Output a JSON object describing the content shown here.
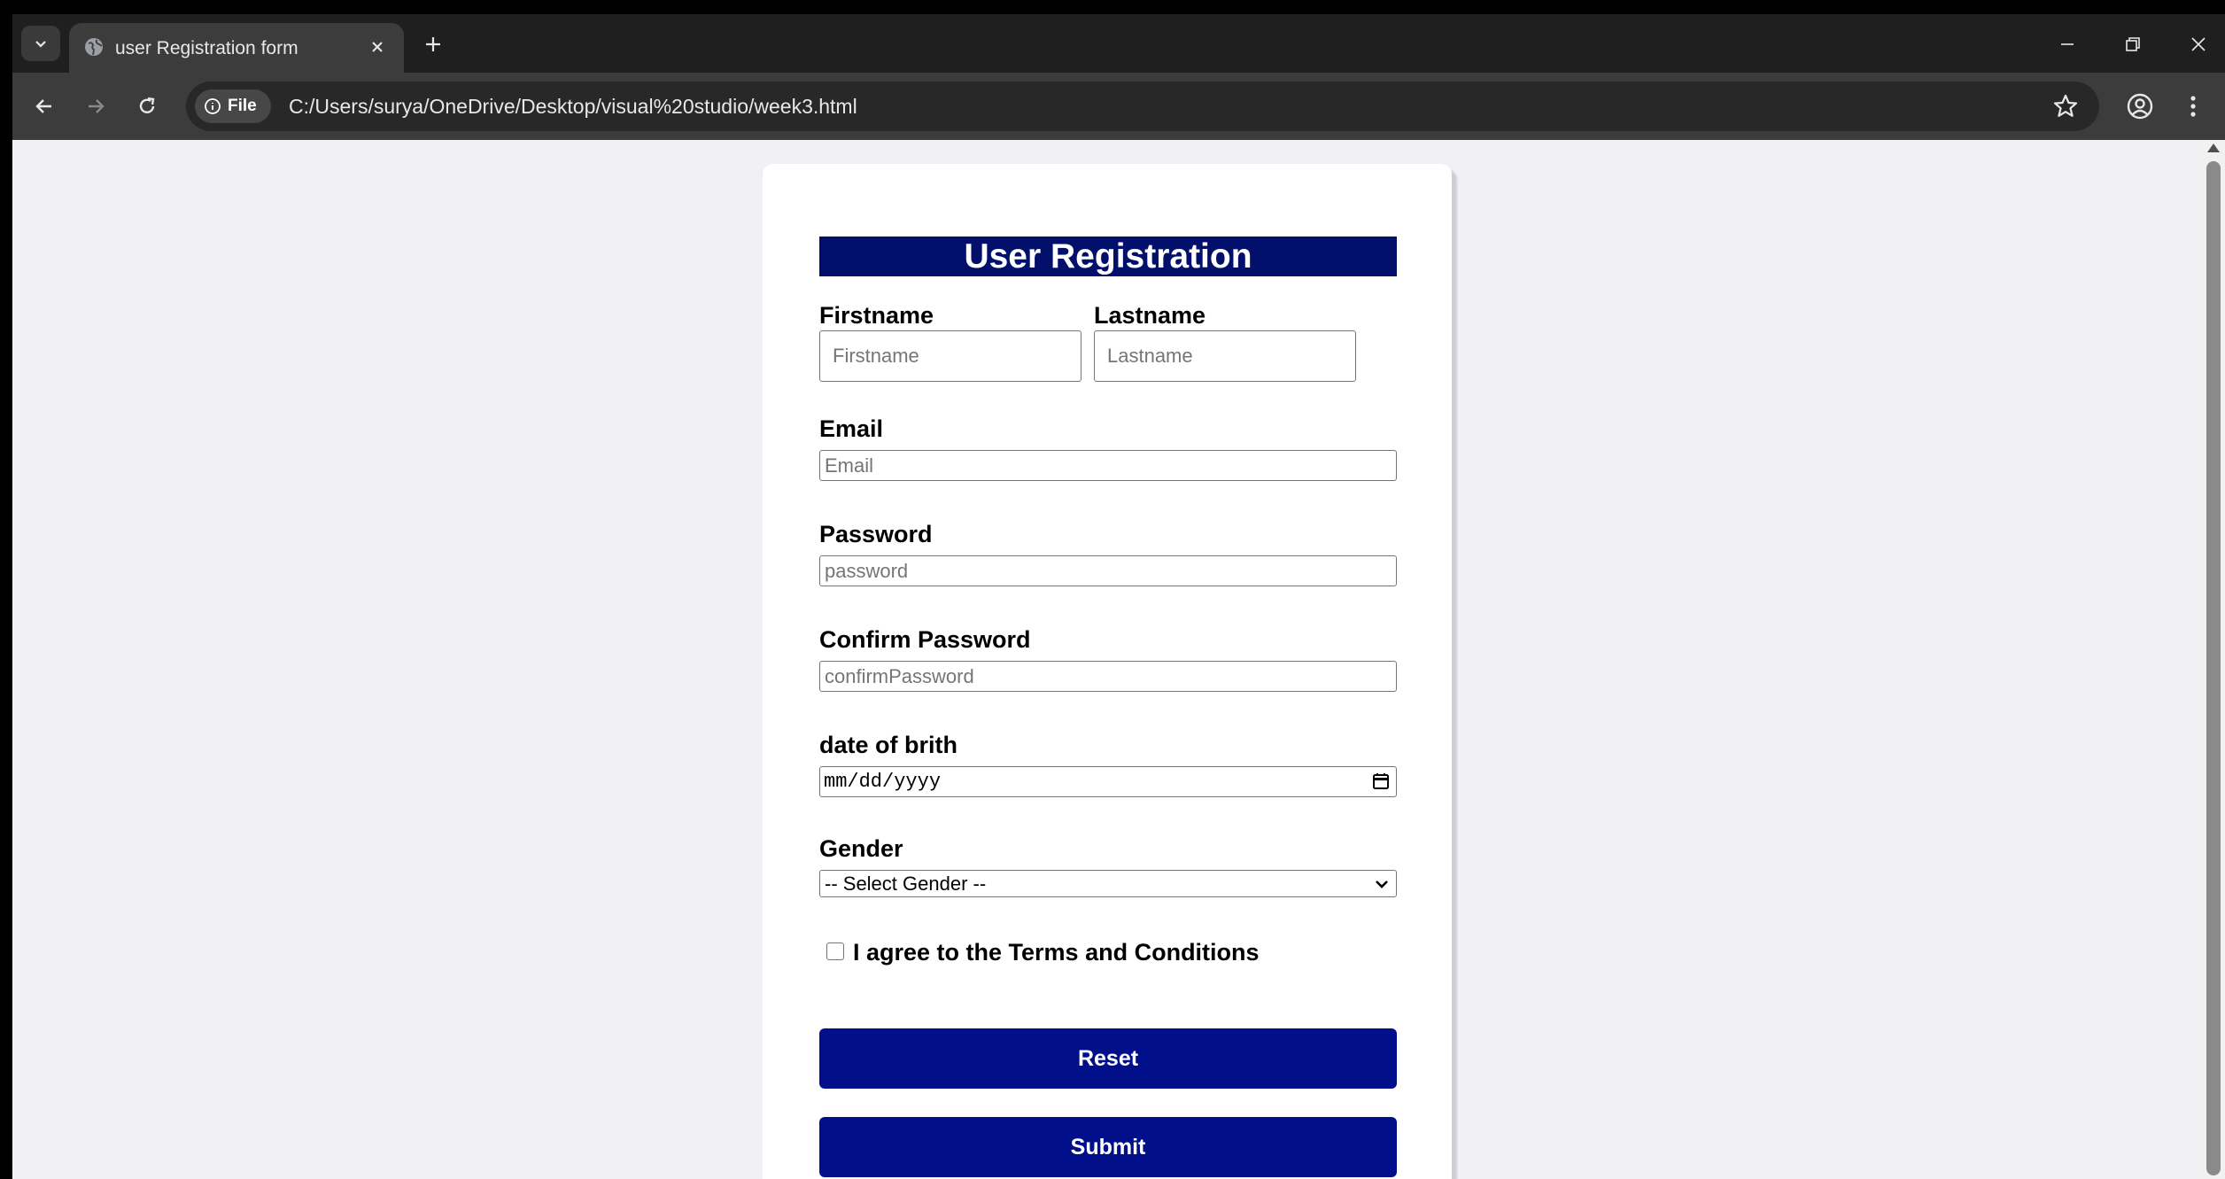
{
  "browser": {
    "tab_title": "user Registration form",
    "site_chip": "File",
    "url": "C:/Users/surya/OneDrive/Desktop/visual%20studio/week3.html"
  },
  "form": {
    "title": "User Registration",
    "firstname_label": "Firstname",
    "firstname_placeholder": "Firstname",
    "lastname_label": "Lastname",
    "lastname_placeholder": "Lastname",
    "email_label": "Email",
    "email_placeholder": "Email",
    "password_label": "Password",
    "password_placeholder": "password",
    "confirm_label": "Confirm Password",
    "confirm_placeholder": "confirmPassword",
    "dob_label": "date of brith",
    "dob_placeholder": "mm/dd/yyyy",
    "gender_label": "Gender",
    "gender_selected": "-- Select Gender --",
    "terms_label": "I agree to the Terms and Conditions",
    "reset_label": "Reset",
    "submit_label": "Submit"
  },
  "colors": {
    "accent": "#020f8a",
    "title_bg": "#020f6b",
    "page_bg": "#f0f0f5"
  }
}
